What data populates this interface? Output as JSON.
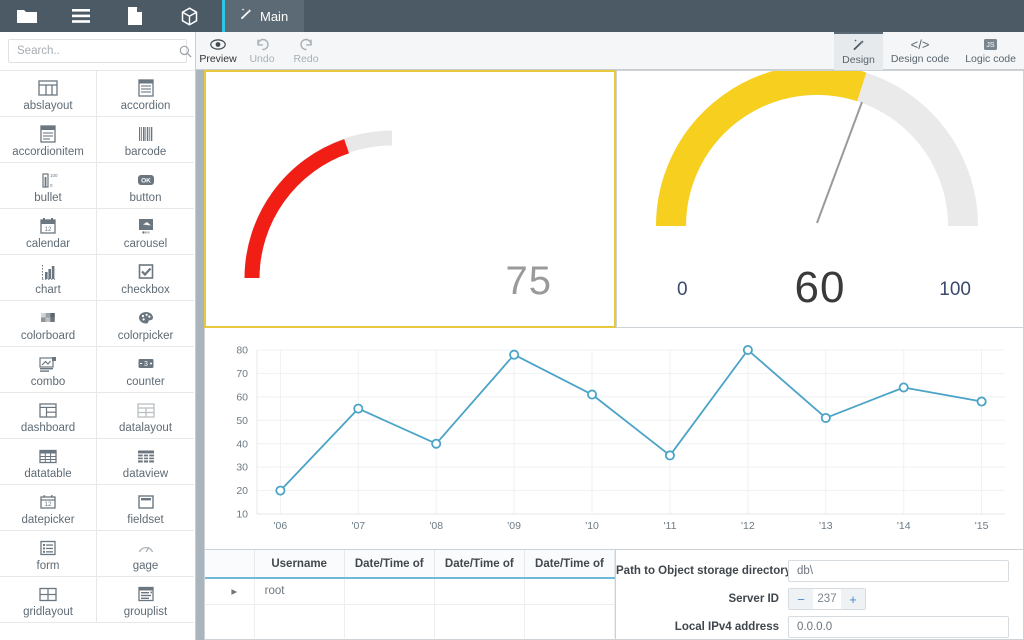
{
  "topbar": {
    "buttons": [
      {
        "name": "folder-icon",
        "label": "Folder"
      },
      {
        "name": "menu-icon",
        "label": "Menu"
      },
      {
        "name": "file-icon",
        "label": "File"
      },
      {
        "name": "package-icon",
        "label": "Package"
      }
    ],
    "tab": {
      "label": "Main"
    },
    "accent_color": "#2ec5e8",
    "bg_color": "#4c5a66"
  },
  "sidebar": {
    "search": {
      "placeholder": "Search..",
      "value": ""
    },
    "items": [
      {
        "label": "abslayout",
        "icon": "abslayout-icon"
      },
      {
        "label": "accordion",
        "icon": "accordion-icon"
      },
      {
        "label": "accordionitem",
        "icon": "accordionitem-icon"
      },
      {
        "label": "barcode",
        "icon": "barcode-icon"
      },
      {
        "label": "bullet",
        "icon": "bullet-icon"
      },
      {
        "label": "button",
        "icon": "button-icon"
      },
      {
        "label": "calendar",
        "icon": "calendar-icon"
      },
      {
        "label": "carousel",
        "icon": "carousel-icon"
      },
      {
        "label": "chart",
        "icon": "chart-icon"
      },
      {
        "label": "checkbox",
        "icon": "checkbox-icon"
      },
      {
        "label": "colorboard",
        "icon": "colorboard-icon"
      },
      {
        "label": "colorpicker",
        "icon": "colorpicker-icon"
      },
      {
        "label": "combo",
        "icon": "combo-icon"
      },
      {
        "label": "counter",
        "icon": "counter-icon"
      },
      {
        "label": "dashboard",
        "icon": "dashboard-icon"
      },
      {
        "label": "datalayout",
        "icon": "datalayout-icon"
      },
      {
        "label": "datatable",
        "icon": "datatable-icon"
      },
      {
        "label": "dataview",
        "icon": "dataview-icon"
      },
      {
        "label": "datepicker",
        "icon": "datepicker-icon"
      },
      {
        "label": "fieldset",
        "icon": "fieldset-icon"
      },
      {
        "label": "form",
        "icon": "form-icon"
      },
      {
        "label": "gage",
        "icon": "gage-icon"
      },
      {
        "label": "gridlayout",
        "icon": "gridlayout-icon"
      },
      {
        "label": "grouplist",
        "icon": "grouplist-icon"
      }
    ]
  },
  "toolbar": {
    "left": [
      {
        "label": "Preview",
        "icon": "eye-icon",
        "state": "active"
      },
      {
        "label": "Undo",
        "icon": "undo-icon",
        "state": "disabled"
      },
      {
        "label": "Redo",
        "icon": "redo-icon",
        "state": "disabled"
      }
    ],
    "right": [
      {
        "label": "Design",
        "icon": "wand-icon",
        "selected": true
      },
      {
        "label": "Design code",
        "icon": "code-icon",
        "selected": false
      },
      {
        "label": "Logic code",
        "icon": "js-icon",
        "selected": false
      }
    ]
  },
  "canvas": {
    "bullet_gauge": {
      "value": "75",
      "value_number": 75,
      "max": 100,
      "arc_color": "#f01e14",
      "track_color": "#e8e8e8",
      "selected": true,
      "selection_color": "#e9c93c"
    },
    "radial_gauge": {
      "value": "60",
      "value_number": 60,
      "min_label": "0",
      "max_label": "100",
      "arc_color": "#f7cf1e",
      "track_color": "#eaeaea",
      "needle_color": "#9a9a9a"
    },
    "table": {
      "columns": [
        "",
        "Username",
        "Date/Time of",
        "Date/Time of",
        "Date/Time of"
      ],
      "rows": [
        {
          "expander": "▸",
          "username": "root",
          "c2": "",
          "c3": "",
          "c4": ""
        }
      ]
    },
    "form": {
      "fields": [
        {
          "label": "Path to Object storage directory",
          "type": "text",
          "value": "db\\"
        },
        {
          "label": "Server ID",
          "type": "stepper",
          "value": "237",
          "minus": "−",
          "plus": "+"
        },
        {
          "label": "Local IPv4 address",
          "type": "text",
          "value": "0.0.0.0"
        }
      ]
    }
  },
  "chart_data": {
    "type": "line",
    "title": "",
    "xlabel": "",
    "ylabel": "",
    "categories": [
      "'06",
      "'07",
      "'08",
      "'09",
      "'10",
      "'11",
      "'12",
      "'13",
      "'14",
      "'15"
    ],
    "values": [
      20,
      55,
      40,
      78,
      61,
      35,
      80,
      51,
      64,
      58
    ],
    "yticks": [
      10,
      20,
      30,
      40,
      50,
      60,
      70,
      80
    ],
    "ylim": [
      10,
      80
    ],
    "grid": true,
    "legend": "none",
    "line_color": "#4ba3c7",
    "marker": "circle-open"
  }
}
